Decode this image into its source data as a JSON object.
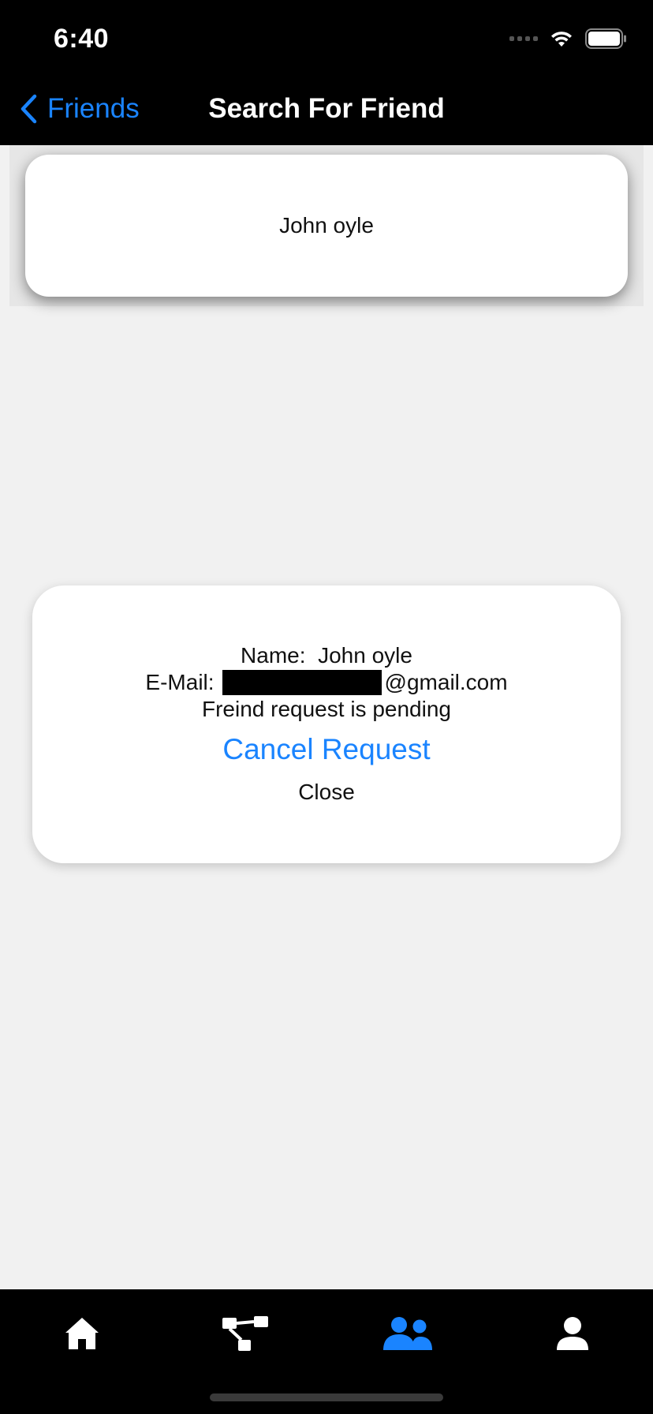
{
  "status_bar": {
    "time": "6:40"
  },
  "nav": {
    "back_label": "Friends",
    "title": "Search For Friend"
  },
  "search_result": {
    "name": "John oyle"
  },
  "modal": {
    "name_label": "Name:",
    "name_value": "John oyle",
    "email_label": "E-Mail:",
    "email_domain": "@gmail.com",
    "status_text": "Freind request is pending",
    "cancel_label": "Cancel Request",
    "close_label": "Close"
  },
  "tabbar": {
    "items": [
      {
        "icon": "home-icon",
        "active": false
      },
      {
        "icon": "hierarchy-icon",
        "active": false
      },
      {
        "icon": "friends-icon",
        "active": true
      },
      {
        "icon": "profile-icon",
        "active": false
      }
    ],
    "active_color": "#1a84ff",
    "inactive_color": "#ffffff"
  },
  "colors": {
    "accent": "#1a84ff",
    "background": "#f1f1f1",
    "bar": "#000000"
  }
}
